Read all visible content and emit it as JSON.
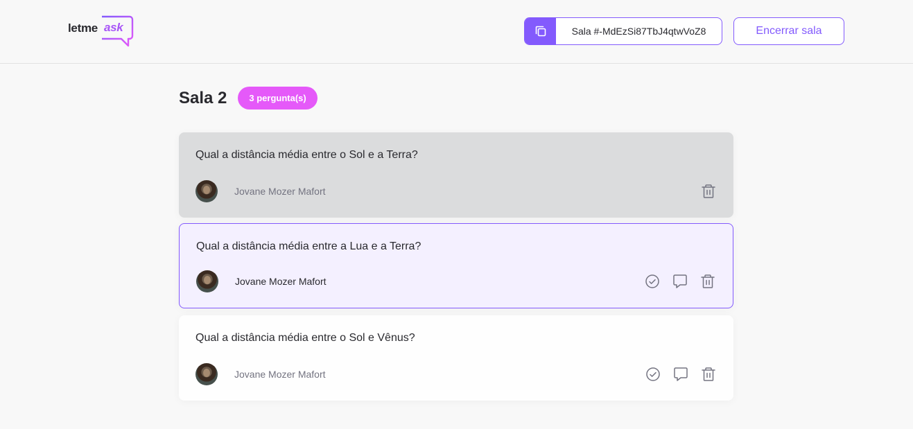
{
  "logo": {
    "part1": "letme",
    "part2": "ask"
  },
  "header": {
    "room_code": "Sala #-MdEzSi87TbJ4qtwVoZ8",
    "close_room_label": "Encerrar sala"
  },
  "room": {
    "title": "Sala 2",
    "question_count": "3 pergunta(s)"
  },
  "questions": [
    {
      "content": "Qual a distância média entre o Sol e a Terra?",
      "author": "Jovane Mozer Mafort",
      "state": "answered"
    },
    {
      "content": "Qual a distância média entre a Lua e a Terra?",
      "author": "Jovane Mozer Mafort",
      "state": "highlighted"
    },
    {
      "content": "Qual a distância média entre o Sol e Vênus?",
      "author": "Jovane Mozer Mafort",
      "state": "normal"
    }
  ],
  "colors": {
    "accent": "#835afd",
    "badge": "#e559f9",
    "answered_bg": "#dbdcdd",
    "highlighted_bg": "#f4f0ff",
    "page_bg": "#f8f8f8"
  },
  "icons": {
    "copy": "copy-icon",
    "check": "check-icon",
    "answer": "answer-icon",
    "delete": "delete-icon"
  }
}
